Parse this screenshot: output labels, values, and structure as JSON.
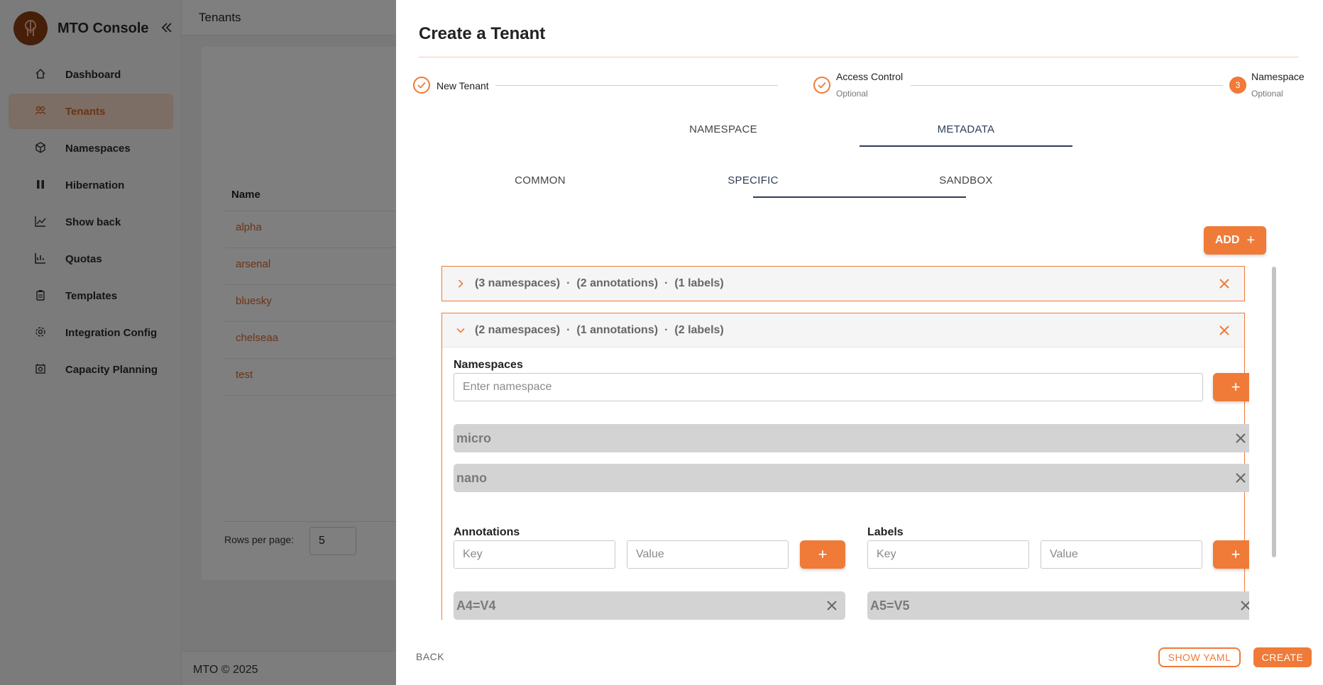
{
  "app": {
    "brand_title": "MTO Console",
    "topbar_title": "Tenants",
    "footer_text": "MTO © 2025"
  },
  "sidebar": {
    "items": [
      {
        "label": "Dashboard",
        "icon": "home-icon"
      },
      {
        "label": "Tenants",
        "icon": "users-icon",
        "active": true
      },
      {
        "label": "Namespaces",
        "icon": "cube-icon"
      },
      {
        "label": "Hibernation",
        "icon": "pause-icon"
      },
      {
        "label": "Show back",
        "icon": "chart-icon"
      },
      {
        "label": "Quotas",
        "icon": "quota-icon"
      },
      {
        "label": "Templates",
        "icon": "clipboard-icon"
      },
      {
        "label": "Integration Config",
        "icon": "gear-icon"
      },
      {
        "label": "Capacity Planning",
        "icon": "capacity-icon"
      }
    ]
  },
  "tenants_table": {
    "header": "Name",
    "rows": [
      "alpha",
      "arsenal",
      "bluesky",
      "chelseaa",
      "test"
    ],
    "rows_per_page_label": "Rows per page:",
    "rows_per_page_value": "5"
  },
  "drawer": {
    "title": "Create a Tenant",
    "steps": [
      {
        "label": "New Tenant",
        "sub": "",
        "status": "done"
      },
      {
        "label": "Access Control",
        "sub": "Optional",
        "status": "done"
      },
      {
        "label": "Namespace",
        "sub": "Optional",
        "status": "active",
        "number": "3"
      }
    ],
    "tabs": [
      "NAMESPACE",
      "METADATA"
    ],
    "subtabs": [
      "COMMON",
      "SPECIFIC",
      "SANDBOX"
    ],
    "add_button": "ADD",
    "groups": [
      {
        "namespaces": "(3 namespaces)",
        "annotations": "(2 annotations)",
        "labels": "(1 labels)",
        "expanded": false
      },
      {
        "namespaces": "(2 namespaces)",
        "annotations": "(1 annotations)",
        "labels": "(2 labels)",
        "expanded": true
      }
    ],
    "separator": "·",
    "form": {
      "namespaces_label": "Namespaces",
      "namespace_placeholder": "Enter namespace",
      "namespace_chips": [
        "micro",
        "nano"
      ],
      "annotations_label": "Annotations",
      "labels_label": "Labels",
      "key_placeholder": "Key",
      "value_placeholder": "Value",
      "annotation_chips": [
        "A4=V4"
      ],
      "label_chips": [
        "A5=V5"
      ]
    },
    "footer": {
      "back": "BACK",
      "show_yaml": "SHOW YAML",
      "create": "CREATE"
    }
  },
  "colors": {
    "accent": "#f07a37",
    "tab_active": "#2f3d57",
    "chip_bg": "#d3d3d3"
  }
}
